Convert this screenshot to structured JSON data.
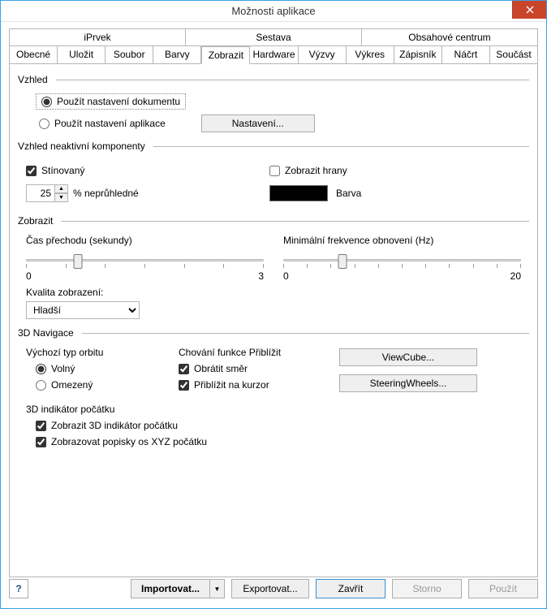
{
  "title": "Možnosti aplikace",
  "tabs_row1": [
    "iPrvek",
    "Sestava",
    "Obsahové centrum"
  ],
  "tabs_row2": [
    "Obecné",
    "Uložit",
    "Soubor",
    "Barvy",
    "Zobrazit",
    "Hardware",
    "Výzvy",
    "Výkres",
    "Zápisník",
    "Náčrt",
    "Součást"
  ],
  "selected_tab": "Zobrazit",
  "sections": {
    "appearance": "Vzhled",
    "inactive_appearance": "Vzhled neaktivní komponenty",
    "display": "Zobrazit",
    "nav3d": "3D Navigace"
  },
  "appearance": {
    "use_doc": "Použít nastavení dokumentu",
    "use_app": "Použít nastavení aplikace",
    "settings_btn": "Nastavení..."
  },
  "inactive": {
    "shaded": "Stínovaný",
    "show_edges": "Zobrazit hrany",
    "opacity_value": "25",
    "opacity_label": "% neprůhledné",
    "color_label": "Barva"
  },
  "display": {
    "transition_label": "Čas přechodu (sekundy)",
    "min_fps_label": "Minimální frekvence obnovení (Hz)",
    "scale_transition": {
      "min": "0",
      "max": "3"
    },
    "scale_fps": {
      "min": "0",
      "max": "20"
    },
    "quality_label": "Kvalita zobrazení:",
    "quality_value": "Hladší"
  },
  "nav": {
    "orbit_label": "Výchozí typ orbitu",
    "orbit_free": "Volný",
    "orbit_constrained": "Omezený",
    "zoom_label": "Chování funkce Přiblížit",
    "reverse": "Obrátit směr",
    "to_cursor": "Přiblížit na kurzor",
    "viewcube_btn": "ViewCube...",
    "steering_btn": "SteeringWheels...",
    "origin_label": "3D indikátor počátku",
    "show_origin": "Zobrazit 3D indikátor počátku",
    "show_xyz": "Zobrazovat popisky os XYZ počátku"
  },
  "footer": {
    "import": "Importovat...",
    "export": "Exportovat...",
    "close": "Zavřít",
    "cancel": "Storno",
    "apply": "Použít"
  }
}
